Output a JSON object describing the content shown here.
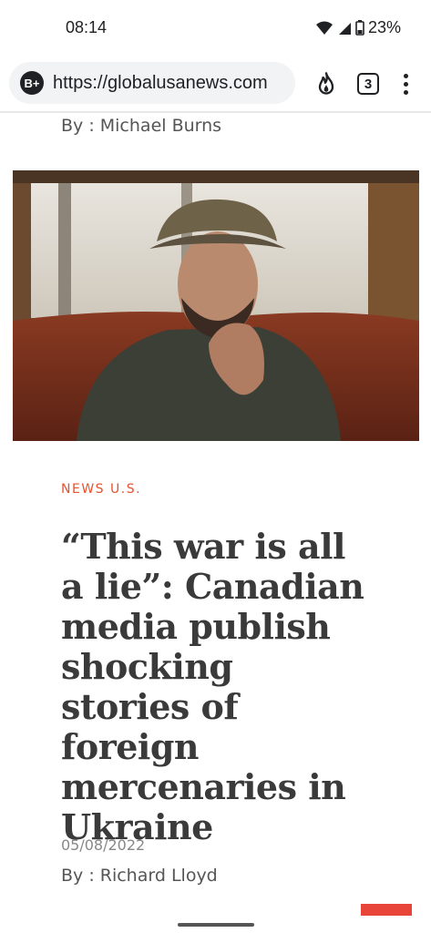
{
  "status_bar": {
    "time": "08:14",
    "battery": "23%"
  },
  "browser": {
    "site_badge": "B+",
    "url": "https://globalusanews.com",
    "tab_count": "3"
  },
  "article": {
    "top_byline": "By : Michael Burns",
    "category": "NEWS U.S.",
    "headline": "“This war is all a lie”: Canadian media publish shocking stories of foreign mercenaries in Ukraine",
    "date": "05/08/2022",
    "byline": "By : Richard Lloyd"
  },
  "colors": {
    "accent": "#e8512f",
    "headline": "#3a3a3a",
    "url_pill": "#f1f3f4"
  }
}
